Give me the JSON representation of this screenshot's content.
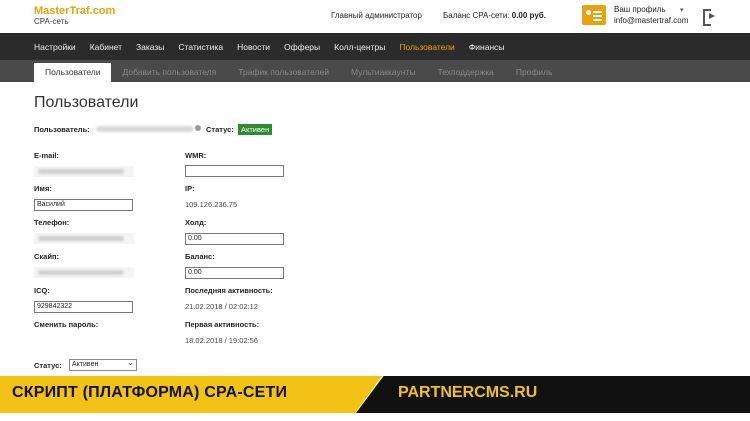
{
  "brand": {
    "name": "MasterTraf.com",
    "sub": "CPA-сеть"
  },
  "header": {
    "admin": "Главный администратор",
    "balance_label": "Баланс CPA-сети:",
    "balance_value": "0.00 руб.",
    "profile_label": "Ваш профиль",
    "profile_email": "info@mastertraf.com"
  },
  "main_nav": [
    "Настройки",
    "Кабинет",
    "Заказы",
    "Статистика",
    "Новости",
    "Офферы",
    "Колл-центры",
    "Пользователи",
    "Финансы"
  ],
  "main_nav_active": "Пользователи",
  "sub_nav": [
    "Пользователи",
    "Добавить пользователя",
    "Трафик пользователей",
    "Мультиаккаунты",
    "Техподдержка",
    "Профиль"
  ],
  "page": {
    "title": "Пользователи",
    "user_label": "Пользователь:",
    "status_label": "Статус:",
    "status_badge": "Активен"
  },
  "form": {
    "email_label": "E-mail:",
    "name_label": "Имя:",
    "name_value": "Василий",
    "phone_label": "Телефон:",
    "skype_label": "Скайп:",
    "icq_label": "ICQ:",
    "icq_value": "929842322",
    "password_label": "Сменить пароль:",
    "wmr_label": "WMR:",
    "wmr_value": "",
    "ip_label": "IP:",
    "ip_value": "109.126.236.75",
    "hold_label": "Холд:",
    "hold_value": "0.00",
    "balance_label": "Баланс:",
    "balance_value": "0.00",
    "last_activity_label": "Последняя активность:",
    "last_activity_value": "21.02.2018 / 02:02:12",
    "first_activity_label": "Первая активность:",
    "first_activity_value": "18.02.2018 / 19:02:56",
    "status_label": "Статус:",
    "status_value": "Активен"
  },
  "banner": {
    "left": "СКРИПТ (ПЛАТФОРМА) CPA-СЕТИ",
    "right": "PARTNERCMS.RU"
  },
  "colors": {
    "accent": "#e8a20c",
    "nav_bg": "#2b2b2b",
    "subnav_bg": "#4a4a4a",
    "badge": "#2e8b2e",
    "banner_yellow": "#f2c214"
  }
}
